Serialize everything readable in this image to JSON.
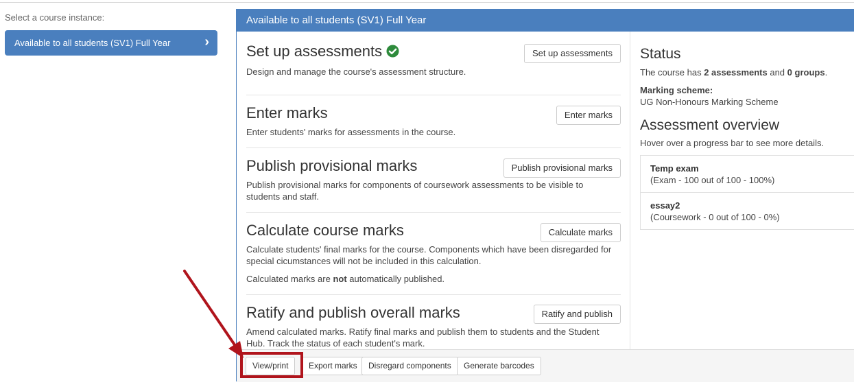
{
  "sidebar": {
    "label": "Select a course instance:",
    "instance_button": "Available to all students (SV1) Full Year"
  },
  "panel": {
    "heading": "Available to all students (SV1) Full Year",
    "steps": [
      {
        "title": "Set up assessments",
        "desc": "Design and manage the course's assessment structure.",
        "button": "Set up assessments",
        "complete": true
      },
      {
        "title": "Enter marks",
        "desc": "Enter students' marks for assessments in the course.",
        "button": "Enter marks"
      },
      {
        "title": "Publish provisional marks",
        "desc": "Publish provisional marks for components of coursework assessments to be visible to students and staff.",
        "button": "Publish provisional marks"
      },
      {
        "title": "Calculate course marks",
        "desc": "Calculate students' final marks for the course. Components which have been disregarded for special cicumstances will not be included in this calculation.",
        "desc2_pre": "Calculated marks are ",
        "desc2_bold": "not",
        "desc2_post": " automatically published.",
        "button": "Calculate marks"
      },
      {
        "title": "Ratify and publish overall marks",
        "desc": "Amend calculated marks. Ratify final marks and publish them to students and the Student Hub. Track the status of each student's mark.",
        "button": "Ratify and publish"
      }
    ],
    "status": {
      "title": "Status",
      "line_pre": "The course has ",
      "assessments": "2 assessments",
      "line_mid": " and ",
      "groups": "0 groups",
      "line_post": ".",
      "scheme_label": "Marking scheme:",
      "scheme_value": "UG Non-Honours Marking Scheme"
    },
    "overview": {
      "title": "Assessment overview",
      "hint": "Hover over a progress bar to see more details.",
      "items": [
        {
          "name": "Temp exam",
          "detail": "(Exam - 100 out of 100 - 100%)"
        },
        {
          "name": "essay2",
          "detail": "(Coursework - 0 out of 100 - 0%)"
        }
      ]
    },
    "footer": {
      "view_print": "View/print",
      "export_marks": "Export marks",
      "disregard_components": "Disregard components",
      "generate_barcodes": "Generate barcodes"
    }
  },
  "colors": {
    "accent": "#4a7fbe",
    "annotation": "#b0141c",
    "success": "#2e8b3c"
  },
  "icons": {
    "complete": "check-circle-icon",
    "instance_chevron": "chevron-right-icon"
  }
}
